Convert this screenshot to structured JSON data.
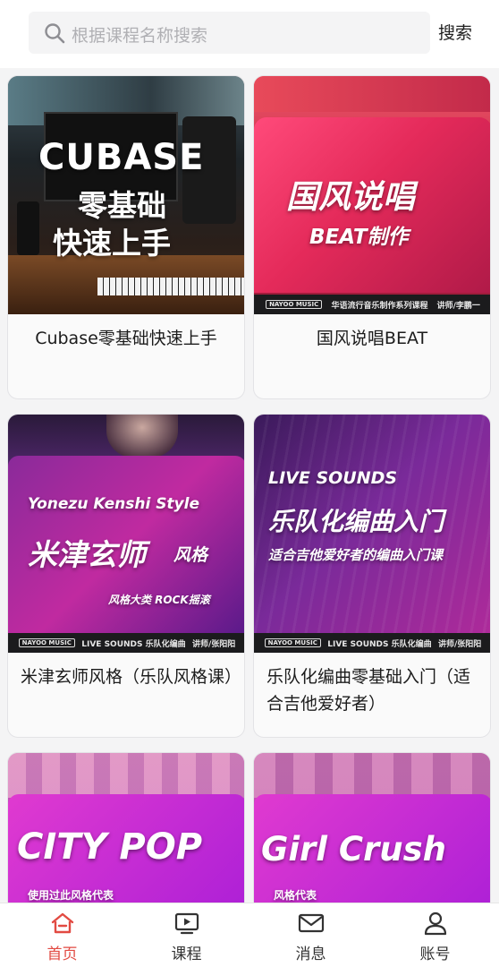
{
  "search": {
    "placeholder": "根据课程名称搜索",
    "button_label": "搜索"
  },
  "courses": [
    {
      "title": "Cubase零基础快速上手",
      "art": {
        "line1": "CUBASE",
        "line2": "零基础",
        "line3": "快速上手"
      }
    },
    {
      "title": "国风说唱BEAT",
      "art": {
        "line1": "国风说唱",
        "line2": "BEAT制作",
        "strip_logo": "NAYOO MUSIC",
        "strip_text": "华语流行音乐制作系列课程",
        "strip_teacher": "讲师/李鹏一"
      }
    },
    {
      "title": "米津玄师风格（乐队风格课）",
      "art": {
        "line1": "Yonezu Kenshi Style",
        "line2": "米津玄师",
        "line3": "风格",
        "line4": "风格大类 ROCK摇滚",
        "strip_logo": "NAYOO MUSIC",
        "strip_text": "LIVE SOUNDS 乐队化编曲",
        "strip_teacher": "讲师/张阳阳"
      }
    },
    {
      "title": "乐队化编曲零基础入门（适合吉他爱好者）",
      "art": {
        "line1": "LIVE SOUNDS",
        "line2": "乐队化编曲入门",
        "line3": "适合吉他爱好者的编曲入门课",
        "strip_logo": "NAYOO MUSIC",
        "strip_text": "LIVE SOUNDS 乐队化编曲",
        "strip_teacher": "讲师/张阳阳"
      }
    },
    {
      "title": "",
      "art": {
        "line1": "CITY POP",
        "line2": "使用过此风格代表"
      }
    },
    {
      "title": "",
      "art": {
        "line1": "Girl Crush",
        "line2": "风格代表"
      }
    }
  ],
  "tabbar": {
    "items": [
      {
        "label": "首页",
        "icon": "home-icon",
        "active": true
      },
      {
        "label": "课程",
        "icon": "play-screen-icon",
        "active": false
      },
      {
        "label": "消息",
        "icon": "mail-icon",
        "active": false
      },
      {
        "label": "账号",
        "icon": "user-icon",
        "active": false
      }
    ]
  },
  "colors": {
    "accent": "#e24a42",
    "background": "#f4f4f5"
  }
}
